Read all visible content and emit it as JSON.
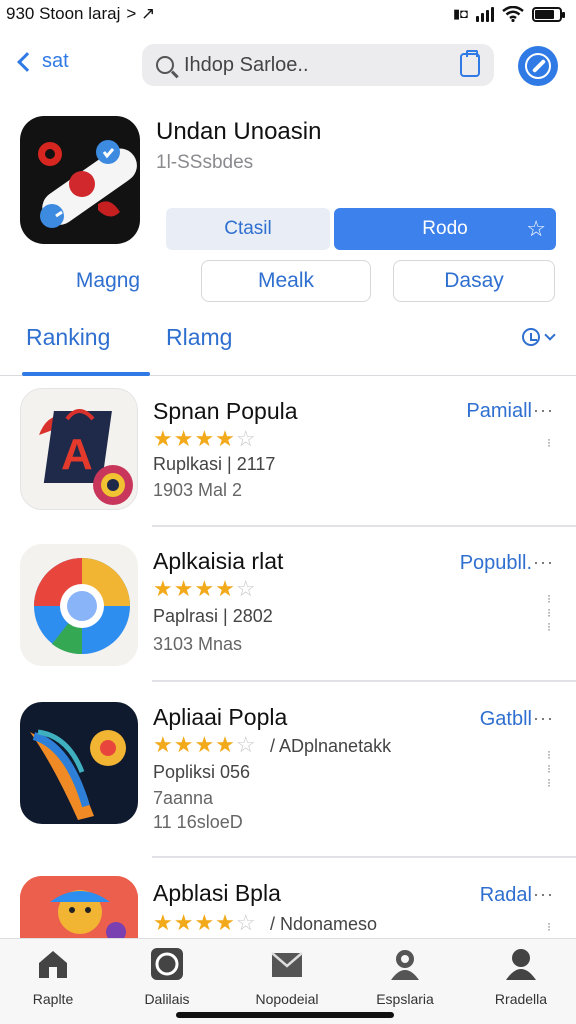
{
  "status_bar": {
    "time": "930 Stoon laraj",
    "nav_arrows": "> ↗"
  },
  "header": {
    "back_label": "sat",
    "search_placeholder": "Ihdop Sarloe.."
  },
  "featured": {
    "title": "Undan Unoasin",
    "subtitle": "1l-SSsbdes",
    "get_label": "Ctasil",
    "open_label": "Rodo"
  },
  "chips": {
    "plain": "Magng",
    "c1": "Mealk",
    "c2": "Dasay"
  },
  "tabs": {
    "t1": "Ranking",
    "t2": "Rlamg"
  },
  "apps": [
    {
      "name": "Spnan Popula",
      "rating": 4,
      "line1": "Ruplkasi | 2117",
      "line2": "1903 Mal 2",
      "line3": "",
      "action": "Pamiall"
    },
    {
      "name": "Aplkaisia rlat",
      "rating": 4,
      "line1": "Paplrasi | 2802",
      "line2": "3103 Mnas",
      "line3": "",
      "action": "Popubll."
    },
    {
      "name": "Apliaai Popla",
      "rating": 4,
      "extra": "/ ADplnanetakk",
      "line1": "Popliksi 056",
      "line2": "7aanna",
      "line3": "11 16sloeD",
      "action": "Gatbll"
    },
    {
      "name": "Apblasi Bpla",
      "rating": 4,
      "extra": "/ Ndonameso",
      "line1": "",
      "line2": "",
      "line3": "",
      "action": "Radal"
    }
  ],
  "tabbar": [
    {
      "label": "Raplte",
      "icon": "home-icon"
    },
    {
      "label": "Dalilais",
      "icon": "circle-icon"
    },
    {
      "label": "Nopodeial",
      "icon": "inbox-icon"
    },
    {
      "label": "Espslaria",
      "icon": "person-icon"
    },
    {
      "label": "Rradella",
      "icon": "profile-icon"
    }
  ],
  "colors": {
    "accent": "#2f7ae5",
    "star": "#f2a91a"
  }
}
